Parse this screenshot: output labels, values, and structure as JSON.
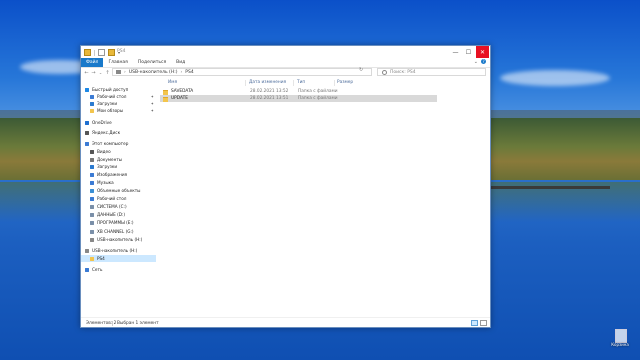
{
  "window": {
    "title": "PS4",
    "ribbon_tabs": [
      "Файл",
      "Главная",
      "Поделиться",
      "Вид"
    ]
  },
  "address_bar": {
    "crumbs": [
      "USB-накопитель (H:)",
      "PS4"
    ]
  },
  "search": {
    "placeholder": "Поиск: PS4"
  },
  "navigation": {
    "items": [
      {
        "label": "Быстрый доступ",
        "icon": "star-icon",
        "color": "#1e88e5",
        "pinned": false,
        "selected": false
      },
      {
        "label": "Рабочий стол",
        "icon": "desktop-icon",
        "color": "#3b7bd4",
        "pinned": true,
        "selected": false
      },
      {
        "label": "Загрузки",
        "icon": "download-icon",
        "color": "#2a7ad0",
        "pinned": true,
        "selected": false
      },
      {
        "label": "Мои обзоры",
        "icon": "folder-icon",
        "color": "#f3c54c",
        "pinned": true,
        "selected": false
      },
      {
        "label": "OneDrive",
        "icon": "cloud-icon",
        "color": "#1e6fd0",
        "pinned": false,
        "selected": false
      },
      {
        "label": "Яндекс.Диск",
        "icon": "disk-icon",
        "color": "#555555",
        "pinned": false,
        "selected": false
      },
      {
        "label": "Этот компьютер",
        "icon": "computer-icon",
        "color": "#3b7bd4",
        "pinned": false,
        "selected": false
      },
      {
        "label": "Видео",
        "icon": "video-icon",
        "color": "#555555",
        "pinned": false,
        "selected": false
      },
      {
        "label": "Документы",
        "icon": "document-icon",
        "color": "#777777",
        "pinned": false,
        "selected": false
      },
      {
        "label": "Загрузки",
        "icon": "download-icon",
        "color": "#2a7ad0",
        "pinned": false,
        "selected": false
      },
      {
        "label": "Изображения",
        "icon": "image-icon",
        "color": "#3b7bd4",
        "pinned": false,
        "selected": false
      },
      {
        "label": "Музыка",
        "icon": "music-icon",
        "color": "#3b7bd4",
        "pinned": false,
        "selected": false
      },
      {
        "label": "Объемные объекты",
        "icon": "cube-icon",
        "color": "#3b8fd4",
        "pinned": false,
        "selected": false
      },
      {
        "label": "Рабочий стол",
        "icon": "desktop-icon",
        "color": "#3b7bd4",
        "pinned": false,
        "selected": false
      },
      {
        "label": "СИСТЕМА (C:)",
        "icon": "drive-icon",
        "color": "#7a8fa8",
        "pinned": false,
        "selected": false
      },
      {
        "label": "ДАННЫЕ (D:)",
        "icon": "drive-icon",
        "color": "#7a8fa8",
        "pinned": false,
        "selected": false
      },
      {
        "label": "ПРОГРАММЫ (E:)",
        "icon": "drive-icon",
        "color": "#7a8fa8",
        "pinned": false,
        "selected": false
      },
      {
        "label": "XB CHANNEL (G:)",
        "icon": "drive-icon",
        "color": "#7a8fa8",
        "pinned": false,
        "selected": false
      },
      {
        "label": "USB-накопитель (H:)",
        "icon": "usb-icon",
        "color": "#888888",
        "pinned": false,
        "selected": false
      },
      {
        "label": "USB-накопитель (H:)",
        "icon": "usb-icon",
        "color": "#888888",
        "pinned": false,
        "selected": false
      },
      {
        "label": "PS4",
        "icon": "folder-icon",
        "color": "#f3c54c",
        "pinned": false,
        "selected": true
      },
      {
        "label": "Сеть",
        "icon": "network-icon",
        "color": "#3b7bd4",
        "pinned": false,
        "selected": false
      }
    ]
  },
  "file_list": {
    "columns": [
      "Имя",
      "Дата изменения",
      "Тип",
      "Размер"
    ],
    "rows": [
      {
        "name": "SAVEDATA",
        "date": "28.02.2021 13:52",
        "type": "Папка с файлами",
        "size": "",
        "selected": false
      },
      {
        "name": "UPDATE",
        "date": "28.02.2021 13:51",
        "type": "Папка с файлами",
        "size": "",
        "selected": true
      }
    ]
  },
  "status": {
    "count": "Элементов: 2",
    "selected": "Выбран 1 элемент"
  },
  "desktop": {
    "recycle_bin_label": "Корзина"
  },
  "colors": {
    "accent": "#1979ca",
    "close": "#e81123",
    "selection": "#cce8ff"
  }
}
